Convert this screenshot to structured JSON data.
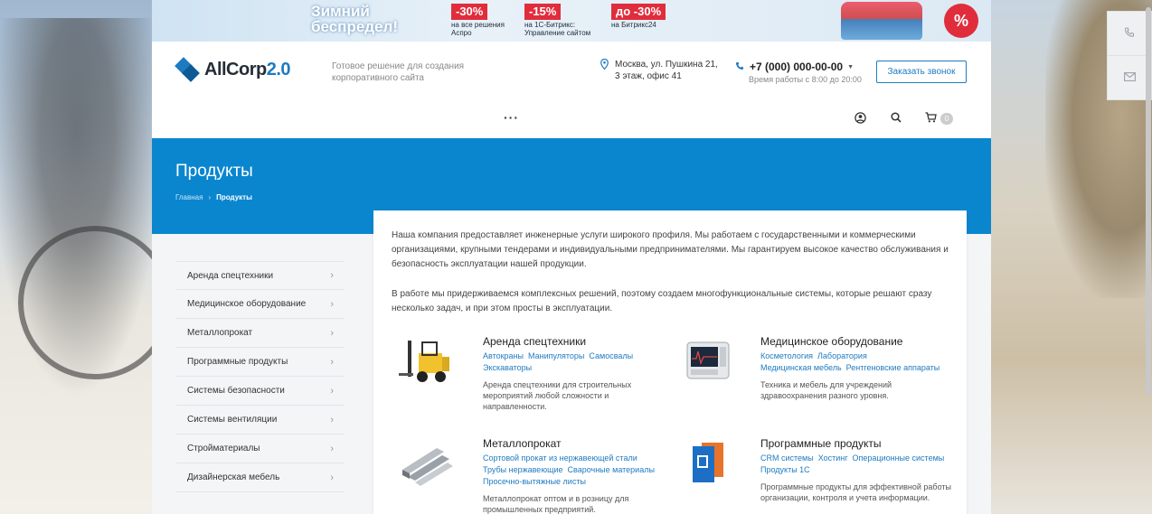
{
  "promo": {
    "title_line1": "Зимний",
    "title_line2": "беспредел!",
    "offers": [
      {
        "badge": "-30%",
        "line1": "на все решения",
        "line2": "Аспро"
      },
      {
        "badge": "-15%",
        "line1": "на 1С-Битрикс:",
        "line2": "Управление сайтом"
      },
      {
        "badge": "до -30%",
        "line1": "на Битрикс24",
        "line2": ""
      }
    ],
    "percent_icon": "%"
  },
  "header": {
    "logo_main": "AllCorp",
    "logo_version": "2.0",
    "tagline": "Готовое решение для создания корпоративного сайта",
    "address": "Москва, ул. Пушкина 21, 3 этаж, офис 41",
    "phone": "+7 (000) 000-00-00",
    "work_hours": "Время работы с 8:00 до 20:00",
    "callback_label": "Заказать звонок",
    "menu_more": "···",
    "cart_count": "0",
    "icons": {
      "pin": "map-pin-icon",
      "phone": "phone-icon",
      "user": "user-icon",
      "search": "search-icon",
      "cart": "cart-icon"
    }
  },
  "title_band": {
    "title": "Продукты",
    "breadcrumb_home": "Главная",
    "breadcrumb_sep": "›",
    "breadcrumb_current": "Продукты"
  },
  "sidebar": {
    "items": [
      {
        "label": "Аренда спецтехники"
      },
      {
        "label": "Медицинское оборудование"
      },
      {
        "label": "Металлопрокат"
      },
      {
        "label": "Программные продукты"
      },
      {
        "label": "Системы безопасности"
      },
      {
        "label": "Системы вентиляции"
      },
      {
        "label": "Стройматериалы"
      },
      {
        "label": "Дизайнерская мебель"
      }
    ]
  },
  "main": {
    "intro_p1": "Наша компания предоставляет инженерные услуги широкого профиля. Мы работаем с государственными и коммерческими организациями, крупными тендерами и индивидуальными предпринимателями. Мы гарантируем высокое качество обслуживания и безопасность эксплуатации нашей продукции.",
    "intro_p2": "В работе мы придерживаемся комплексных решений, поэтому создаем многофункциональные системы, которые решают сразу несколько задач, и при этом просты в эксплуатации.",
    "products": [
      {
        "title": "Аренда спецтехники",
        "links": [
          "Автокраны",
          "Манипуляторы",
          "Самосвалы",
          "Экскаваторы"
        ],
        "desc": "Аренда спецтехники для строительных мероприятий любой сложности и направленности."
      },
      {
        "title": "Медицинское оборудование",
        "links": [
          "Косметология",
          "Лаборатория",
          "Медицинская мебель",
          "Рентгеновские аппараты"
        ],
        "desc": "Техника и мебель для учреждений здравоохранения разного уровня."
      },
      {
        "title": "Металлопрокат",
        "links": [
          "Сортовой прокат из нержавеющей стали",
          "Трубы нержавеющие",
          "Сварочные материалы",
          "Просечно-вытяжные листы"
        ],
        "desc": "Металлопрокат оптом и в розницу для промышленных предприятий."
      },
      {
        "title": "Программные продукты",
        "links": [
          "CRM системы",
          "Хостинг",
          "Операционные системы",
          "Продукты 1С"
        ],
        "desc": "Программные продукты для эффективной работы организации, контроля и учета информации."
      }
    ]
  },
  "colors": {
    "accent": "#1f7bc1",
    "band": "#0a86cf",
    "promo_red": "#e02d3c"
  }
}
